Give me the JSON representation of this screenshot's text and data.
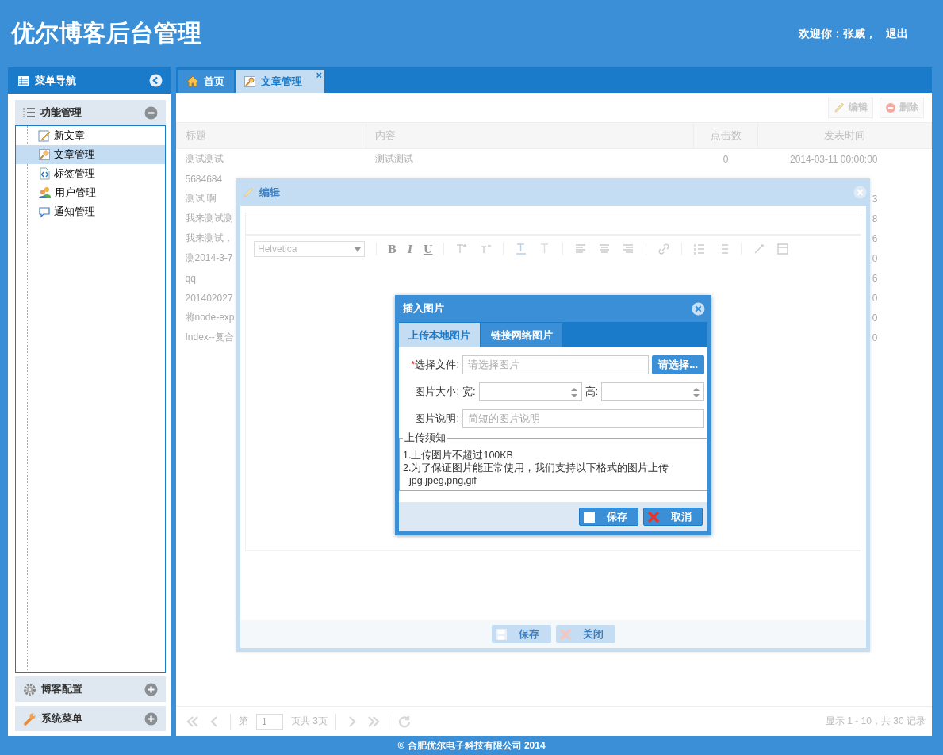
{
  "header": {
    "title": "优尔博客后台管理",
    "welcome": "欢迎你：张威，",
    "logout": "退出"
  },
  "sidebar": {
    "title": "菜单导航",
    "sections": [
      {
        "label": "功能管理",
        "expanded": true,
        "items": [
          {
            "label": "新文章",
            "selected": false
          },
          {
            "label": "文章管理",
            "selected": true
          },
          {
            "label": "标签管理",
            "selected": false
          },
          {
            "label": "用户管理",
            "selected": false
          },
          {
            "label": "通知管理",
            "selected": false
          }
        ]
      },
      {
        "label": "博客配置",
        "expanded": false
      },
      {
        "label": "系统菜单",
        "expanded": false
      }
    ]
  },
  "tabs": [
    {
      "label": "首页",
      "selected": false
    },
    {
      "label": "文章管理",
      "selected": true,
      "close": "×"
    }
  ],
  "toolbar": [
    "编辑",
    "删除"
  ],
  "table": {
    "columns": [
      "标题",
      "内容",
      "点击数",
      "发表时间"
    ],
    "rows": [
      {
        "title": "测试测试",
        "content": "测试测试",
        "clicks": "0",
        "date": "2014-03-11 00:00:00"
      },
      {
        "title": "5684684"
      },
      {
        "title": "测试 啊",
        "date": "3"
      },
      {
        "title": "我来测试测",
        "date": "8"
      },
      {
        "title": "我来测试，",
        "date": "6"
      },
      {
        "title": "测2014-3-7",
        "date": "0"
      },
      {
        "title": "qq",
        "date": "6"
      },
      {
        "title": "201402027",
        "date": "0"
      },
      {
        "title": "将node-exp",
        "date": "0"
      },
      {
        "title": "Index--复合",
        "date": "0"
      }
    ]
  },
  "pager": {
    "page_label": "第",
    "page": "1",
    "of_pages": "页共 3页",
    "summary": "显示 1 - 10，共 30 记录"
  },
  "edit_dialog": {
    "title": "编辑",
    "font": "Helvetica",
    "format_buttons": [
      "B",
      "I",
      "U"
    ],
    "buttons": [
      {
        "label": "保存",
        "kind": "save"
      },
      {
        "label": "关闭",
        "kind": "close"
      }
    ]
  },
  "image_dialog": {
    "title": "插入图片",
    "tabs": [
      {
        "label": "上传本地图片",
        "selected": true
      },
      {
        "label": "链接网络图片",
        "selected": false
      }
    ],
    "fields": [
      {
        "kind": "file",
        "required_mark": "*",
        "label": "选择文件:",
        "placeholder": "请选择图片",
        "button": "请选择..."
      },
      {
        "kind": "size",
        "label": "图片大小:",
        "width_label": "宽:",
        "height_label": "高:"
      },
      {
        "kind": "text",
        "label": "图片说明:",
        "placeholder": "简短的图片说明"
      }
    ],
    "notice": {
      "legend": "上传须知",
      "lines": [
        "1.上传图片不超过100KB",
        "2.为了保证图片能正常使用，我们支持以下格式的图片上传",
        "jpg,jpeg,png,gif"
      ]
    },
    "buttons": [
      {
        "label": "保存",
        "kind": "save"
      },
      {
        "label": "取消",
        "kind": "cancel"
      }
    ]
  },
  "footer": "© 合肥优尔电子科技有限公司 2014"
}
